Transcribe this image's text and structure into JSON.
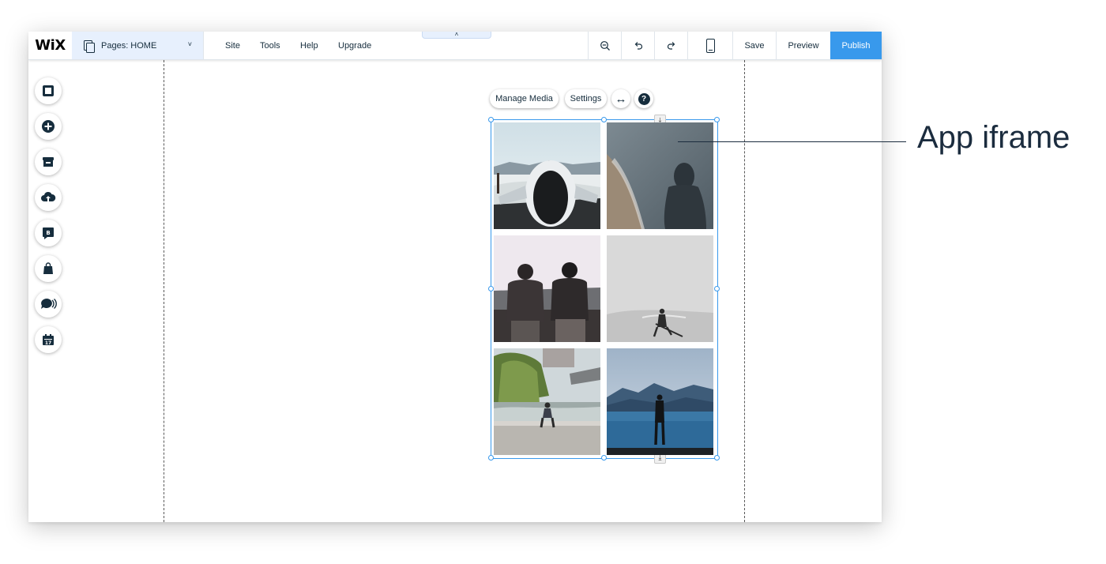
{
  "brand": {
    "logo": "WiX"
  },
  "pages_dropdown": {
    "label": "Pages: HOME",
    "chevron": "˅"
  },
  "menu": {
    "site": "Site",
    "tools": "Tools",
    "help": "Help",
    "upgrade": "Upgrade"
  },
  "collapse_tab": {
    "glyph": "˄"
  },
  "toolbar": {
    "save": "Save",
    "preview": "Preview",
    "publish": "Publish"
  },
  "left_dock": {
    "items": [
      "background-icon",
      "add-icon",
      "app-market-icon",
      "upload-icon",
      "blog-icon",
      "store-icon",
      "chat-icon",
      "bookings-icon"
    ]
  },
  "media_toolbar": {
    "manage_media": "Manage Media",
    "settings": "Settings",
    "stretch_icon": "↔",
    "help_icon": "?"
  },
  "gallery": {
    "download_glyph": "⤓",
    "photos": [
      "plane-wreck-photo",
      "hooded-person-shore-photo",
      "two-men-backs-photo",
      "person-desert-photo",
      "man-sitting-river-photo",
      "man-lake-mountains-photo"
    ]
  },
  "annotation": {
    "label": "App iframe"
  },
  "colors": {
    "accent": "#3899ec",
    "text": "#162d3d",
    "pages_bg": "#e7f0fd"
  }
}
